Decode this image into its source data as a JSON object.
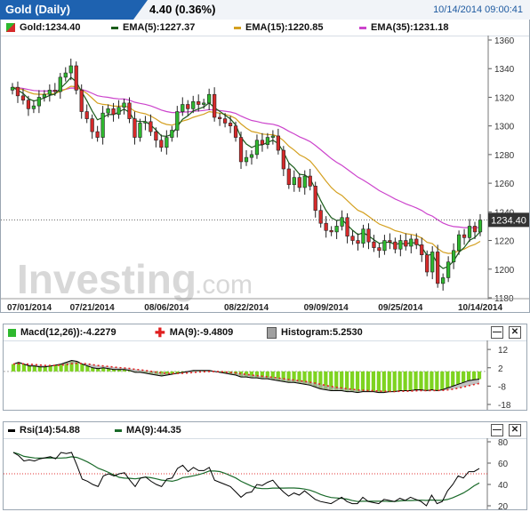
{
  "header": {
    "title": "Gold (Daily)",
    "change": "4.40 (0.36%)",
    "datetime": "10/14/2014 09:00:41"
  },
  "colors": {
    "up": "#2eb82e",
    "down": "#d62a2a",
    "ema5": "#1a5c1a",
    "ema15": "#d4a020",
    "ema35": "#cc44cc",
    "macd": "#000000",
    "macd_signal": "#e02020",
    "histogram": "#7ed321",
    "rsi": "#000000",
    "rsi_ma": "#1a6a2a",
    "brand": "#1e62b0"
  },
  "main_panel": {
    "legend": {
      "gold": "Gold:1234.40",
      "ema5": "EMA(5):1227.37",
      "ema15": "EMA(15):1220.85",
      "ema35": "EMA(35):1231.18"
    },
    "price_label": "1234.40",
    "watermark_logo": "Investing",
    "watermark_suffix": ".com",
    "x_labels": [
      "07/01/2014",
      "07/21/2014",
      "08/06/2014",
      "08/22/2014",
      "09/09/2014",
      "09/25/2014",
      "10/14/2014"
    ]
  },
  "macd_panel": {
    "legend": {
      "macd": "Macd(12,26)):-4.2279",
      "ma": "MA(9):-9.4809",
      "histogram": "Histogram:5.2530"
    }
  },
  "rsi_panel": {
    "legend": {
      "rsi": "Rsi(14):54.88",
      "ma": "MA(9):44.35"
    }
  },
  "chart_data": [
    {
      "type": "candlestick",
      "title": "Gold (Daily)",
      "ylim": [
        1180,
        1360
      ],
      "yticks": [
        1180,
        1200,
        1220,
        1240,
        1260,
        1280,
        1300,
        1320,
        1340,
        1360
      ],
      "xlabels": [
        "07/01/2014",
        "07/21/2014",
        "08/06/2014",
        "08/22/2014",
        "09/09/2014",
        "09/25/2014",
        "10/14/2014"
      ],
      "close": [
        1327,
        1321,
        1318,
        1312,
        1314,
        1320,
        1322,
        1325,
        1324,
        1334,
        1337,
        1342,
        1325,
        1310,
        1305,
        1296,
        1292,
        1309,
        1312,
        1308,
        1313,
        1316,
        1305,
        1292,
        1302,
        1303,
        1296,
        1290,
        1285,
        1292,
        1297,
        1310,
        1315,
        1312,
        1317,
        1315,
        1316,
        1322,
        1306,
        1305,
        1302,
        1300,
        1292,
        1275,
        1278,
        1280,
        1290,
        1287,
        1292,
        1293,
        1283,
        1270,
        1259,
        1264,
        1257,
        1265,
        1258,
        1241,
        1232,
        1227,
        1226,
        1230,
        1236,
        1223,
        1220,
        1218,
        1228,
        1219,
        1215,
        1213,
        1220,
        1219,
        1214,
        1220,
        1216,
        1221,
        1217,
        1210,
        1198,
        1212,
        1190,
        1194,
        1205,
        1213,
        1224,
        1222,
        1230,
        1226,
        1234.4
      ],
      "ema5_last": 1227.37,
      "ema15_last": 1220.85,
      "ema35_last": 1231.18
    },
    {
      "type": "bar",
      "title": "MACD",
      "ylim": [
        -18,
        14
      ],
      "yticks": [
        12,
        2,
        -8,
        -18
      ],
      "macd": [
        4,
        5,
        4,
        3,
        3,
        2.5,
        2.5,
        3,
        3.5,
        4,
        5,
        6,
        5.5,
        4,
        3,
        2,
        1.5,
        2,
        1.5,
        1,
        1,
        1,
        0.5,
        -0.5,
        -0.5,
        -1,
        -1.5,
        -2,
        -2.5,
        -2,
        -1.5,
        -1,
        -0.5,
        0,
        0.5,
        0.5,
        0.5,
        0.5,
        0,
        -0.5,
        -1,
        -1.5,
        -2,
        -3,
        -3,
        -3.5,
        -3.5,
        -4,
        -4,
        -4.5,
        -5,
        -5.5,
        -6,
        -6,
        -6.5,
        -7,
        -7.5,
        -8.5,
        -9.5,
        -10,
        -10.5,
        -10.5,
        -10.5,
        -11,
        -11,
        -11.5,
        -11,
        -11,
        -11,
        -11.5,
        -11.5,
        -11,
        -11,
        -10.5,
        -10.5,
        -10.5,
        -10,
        -10,
        -10.5,
        -10,
        -10.5,
        -10,
        -9,
        -8,
        -7,
        -6,
        -5,
        -4.5,
        -4.2
      ],
      "signal_last": -9.4809,
      "histogram_last": 5.253
    },
    {
      "type": "line",
      "title": "RSI",
      "ylim": [
        20,
        80
      ],
      "yticks": [
        80,
        60,
        40,
        20
      ],
      "rsi": [
        70,
        67,
        62,
        63,
        62,
        64,
        65,
        66,
        64,
        70,
        69,
        70,
        58,
        45,
        43,
        40,
        38,
        48,
        50,
        48,
        50,
        51,
        44,
        38,
        46,
        47,
        43,
        40,
        38,
        45,
        46,
        55,
        58,
        52,
        56,
        53,
        53,
        56,
        44,
        42,
        40,
        38,
        33,
        28,
        32,
        33,
        40,
        39,
        42,
        44,
        38,
        33,
        29,
        32,
        30,
        34,
        30,
        26,
        24,
        23,
        22,
        25,
        28,
        24,
        22,
        22,
        28,
        24,
        23,
        22,
        26,
        25,
        24,
        27,
        25,
        28,
        26,
        24,
        20,
        30,
        22,
        24,
        34,
        40,
        48,
        46,
        52,
        52,
        54.88
      ],
      "ma_last": 44.35
    }
  ]
}
